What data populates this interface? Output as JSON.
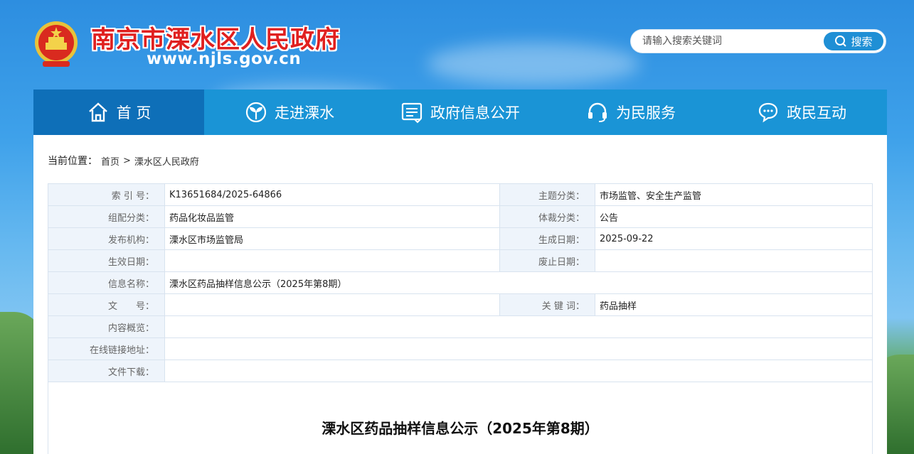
{
  "header": {
    "site_title": "南京市溧水区人民政府",
    "site_url": "www.njls.gov.cn",
    "search_placeholder": "请输入搜索关键词",
    "search_button": "搜索"
  },
  "nav": {
    "items": [
      {
        "label": "首 页",
        "icon": "home-icon",
        "active": true
      },
      {
        "label": "走进溧水",
        "icon": "sprout-icon",
        "active": false
      },
      {
        "label": "政府信息公开",
        "icon": "document-icon",
        "active": false
      },
      {
        "label": "为民服务",
        "icon": "headset-icon",
        "active": false
      },
      {
        "label": "政民互动",
        "icon": "chat-icon",
        "active": false
      }
    ]
  },
  "breadcrumb": {
    "lead": "当前位置：",
    "home": "首页",
    "sep": ">",
    "current": "溧水区人民政府"
  },
  "meta": {
    "index_no_label": "索 引 号：",
    "index_no": "K13651684/2025-64866",
    "topic_label": "主题分类：",
    "topic": "市场监管、安全生产监管",
    "org_cat_label": "组配分类：",
    "org_cat": "药品化妆品监管",
    "genre_label": "体裁分类：",
    "genre": "公告",
    "publisher_label": "发布机构：",
    "publisher": "溧水区市场监管局",
    "created_label": "生成日期：",
    "created": "2025-09-22",
    "effective_label": "生效日期：",
    "effective": "",
    "expire_label": "废止日期：",
    "expire": "",
    "info_name_label": "信息名称：",
    "info_name": "溧水区药品抽样信息公示（2025年第8期）",
    "doc_no_label": "文　　号：",
    "doc_no": "",
    "keywords_label": "关 键 词：",
    "keywords": "药品抽样",
    "summary_label": "内容概览：",
    "summary": "",
    "link_label": "在线链接地址：",
    "link": "",
    "download_label": "文件下载：",
    "download": ""
  },
  "document": {
    "title": "溧水区药品抽样信息公示（2025年第8期）"
  }
}
